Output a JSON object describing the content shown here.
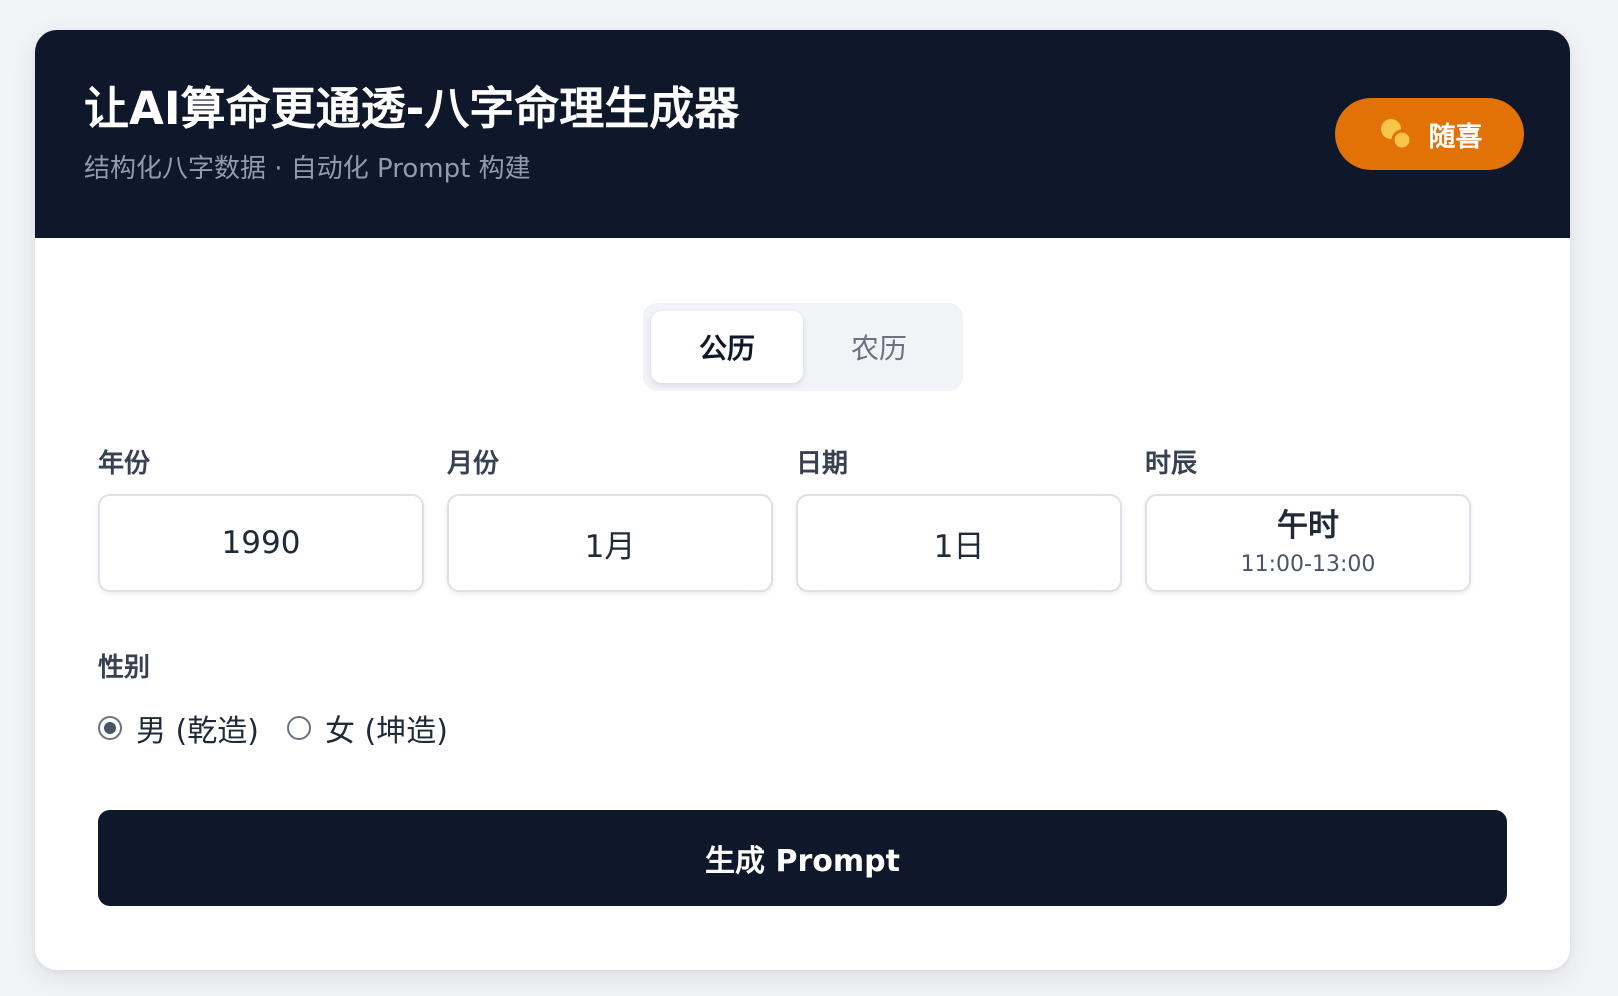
{
  "header": {
    "title": "让AI算命更通透-八字命理生成器",
    "subtitle": "结构化八字数据 · 自动化 Prompt 构建",
    "lucky_button": {
      "label": "随喜",
      "icon": "coins-icon"
    }
  },
  "calendar_toggle": {
    "options": [
      "公历",
      "农历"
    ],
    "selected": "公历"
  },
  "fields": {
    "year": {
      "label": "年份",
      "value": "1990"
    },
    "month": {
      "label": "月份",
      "value": "1月"
    },
    "day": {
      "label": "日期",
      "value": "1日"
    },
    "hour": {
      "label": "时辰",
      "value": "午时",
      "range": "11:00-13:00"
    }
  },
  "gender": {
    "label": "性别",
    "options": [
      "男 (乾造)",
      "女 (坤造)"
    ],
    "selected": "男 (乾造)"
  },
  "generate_button": {
    "label": "生成 Prompt"
  },
  "colors": {
    "header_bg": "#0f172a",
    "accent_orange": "#e27106",
    "page_bg": "#f2f3f6",
    "coin_color": "#f6c54a"
  }
}
